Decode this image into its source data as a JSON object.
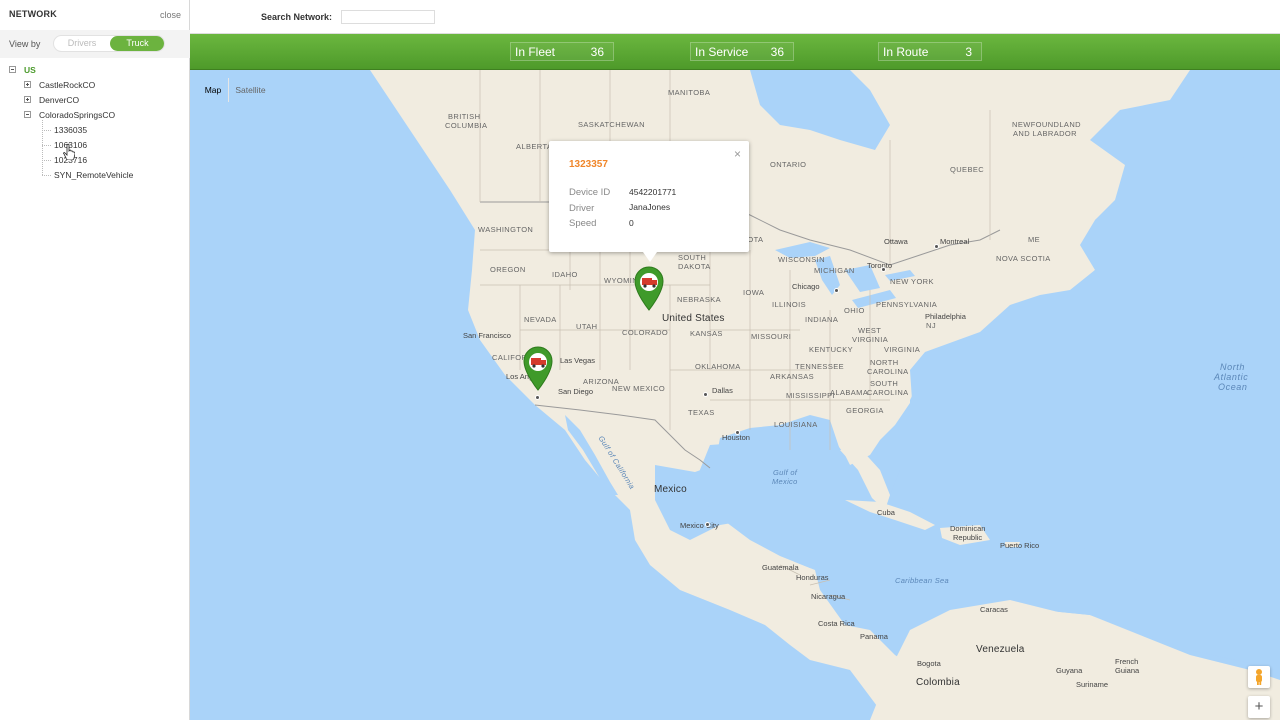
{
  "sidebar": {
    "title": "NETWORK",
    "close": "close",
    "view_by_label": "View by",
    "view_options": [
      "Drivers",
      "Truck"
    ],
    "selected_view": "Truck",
    "tree": {
      "root": "US",
      "groups": [
        {
          "label": "CastleRockCO",
          "expanded": false
        },
        {
          "label": "DenverCO",
          "expanded": false
        },
        {
          "label": "ColoradoSpringsCO",
          "expanded": true,
          "children": [
            "1336035",
            "1063106",
            "1023716",
            "SYN_RemoteVehicle"
          ]
        }
      ]
    }
  },
  "topbar": {
    "search_label": "Search Network:",
    "search_value": "",
    "search_placeholder": ""
  },
  "stats": [
    {
      "label": "In Fleet",
      "value": "36"
    },
    {
      "label": "In Service",
      "value": "36"
    },
    {
      "label": "In Route",
      "value": "3"
    }
  ],
  "map": {
    "type_buttons": [
      "Map",
      "Satellite"
    ],
    "selected_type": "Map",
    "zoom_in": "+",
    "infowindow": {
      "title": "1323357",
      "close": "×",
      "fields": [
        {
          "label": "Device ID",
          "value": "4542201771"
        },
        {
          "label": "Driver",
          "value": "JanaJones"
        },
        {
          "label": "Speed",
          "value": "0"
        }
      ]
    },
    "labels": {
      "manitoba": "MANITOBA",
      "british_columbia_1": "BRITISH",
      "british_columbia_2": "COLUMBIA",
      "alberta": "ALBERTA",
      "saskatchewan": "SASKATCHEWAN",
      "ontario": "ONTARIO",
      "quebec": "QUEBEC",
      "newfoundland_1": "NEWFOUNDLAND",
      "newfoundland_2": "AND LABRADOR",
      "washington": "WASHINGTON",
      "oregon": "OREGON",
      "idaho": "IDAHO",
      "wyoming": "WYOMING",
      "nevada": "NEVADA",
      "utah": "UTAH",
      "california": "CALIFORNIA",
      "arizona": "ARIZONA",
      "colorado": "COLORADO",
      "new_mexico": "NEW MEXICO",
      "south_dakota_1": "SOUTH",
      "south_dakota_2": "DAKOTA",
      "nebraska": "NEBRASKA",
      "kansas": "KANSAS",
      "oklahoma": "OKLAHOMA",
      "texas": "TEXAS",
      "iowa": "IOWA",
      "missouri": "MISSOURI",
      "arkansas": "ARKANSAS",
      "louisiana": "LOUISIANA",
      "wisconsin": "WISCONSIN",
      "michigan": "MICHIGAN",
      "illinois": "ILLINOIS",
      "indiana": "INDIANA",
      "ohio": "OHIO",
      "kentucky": "KENTUCKY",
      "tennessee": "TENNESSEE",
      "mississippi": "MISSISSIPPI",
      "alabama": "ALABAMA",
      "georgia": "GEORGIA",
      "west_virginia_1": "WEST",
      "west_virginia_2": "VIRGINIA",
      "virginia": "VIRGINIA",
      "north_carolina_1": "NORTH",
      "north_carolina_2": "CAROLINA",
      "south_carolina_1": "SOUTH",
      "south_carolina_2": "CAROLINA",
      "new_york": "NEW YORK",
      "pennsylvania": "PENNSYLVANIA",
      "nj": "NJ",
      "me": "ME",
      "nova_scotia": "NOVA SCOTIA",
      "sota": "SOTA",
      "united_states": "United States",
      "mexico": "Mexico",
      "cuba": "Cuba",
      "dominican_1": "Dominican",
      "dominican_2": "Republic",
      "puerto_rico": "Puerto Rico",
      "guatemala": "Guatemala",
      "honduras": "Honduras",
      "nicaragua": "Nicaragua",
      "costa_rica": "Costa Rica",
      "panama": "Panama",
      "venezuela": "Venezuela",
      "colombia": "Colombia",
      "guyana": "Guyana",
      "suriname": "Suriname",
      "french_guiana_1": "French",
      "french_guiana_2": "Guiana",
      "caracas": "Caracas",
      "bogota": "Bogota",
      "san_francisco": "San Francisco",
      "las_vegas": "Las Vegas",
      "los_angeles": "Los Angeles",
      "san_diego": "San Diego",
      "chicago": "Chicago",
      "dallas": "Dallas",
      "houston": "Houston",
      "toronto": "Toronto",
      "ottawa": "Ottawa",
      "montreal": "Montreal",
      "philadelphia": "Philadelphia",
      "mexico_city": "Mexico City",
      "gulf_1": "Gulf of",
      "gulf_2": "Mexico",
      "gulf_california": "Gulf of California",
      "caribbean": "Caribbean Sea",
      "north_atlantic_1": "North",
      "north_atlantic_2": "Atlantic",
      "north_atlantic_3": "Ocean"
    }
  },
  "colors": {
    "accent_green": "#6cb33f",
    "infowindow_title": "#f0862a",
    "water": "#aad3f9",
    "land": "#f0ecdd"
  }
}
